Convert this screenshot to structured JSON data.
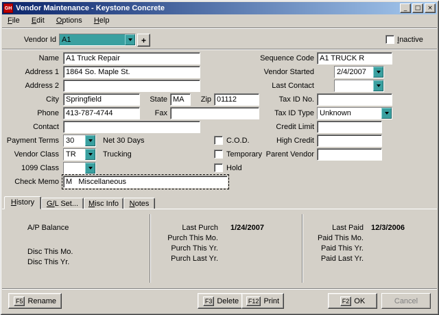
{
  "window": {
    "icon_label": "GH",
    "title": "Vendor Maintenance - Keystone Concrete",
    "minimize_glyph": "_",
    "maximize_glyph": "□",
    "close_glyph": "×"
  },
  "menu": {
    "file": "File",
    "edit": "Edit",
    "options": "Options",
    "help": "Help"
  },
  "topbar": {
    "vendor_id_label": "Vendor Id",
    "vendor_id_value": "A1",
    "add_button_label": "+",
    "inactive_label": "Inactive"
  },
  "fields": {
    "name_label": "Name",
    "name_value": "A1 Truck Repair",
    "address1_label": "Address 1",
    "address1_value": "1864 So. Maple St.",
    "address2_label": "Address 2",
    "address2_value": "",
    "city_label": "City",
    "city_value": "Springfield",
    "state_label": "State",
    "state_value": "MA",
    "zip_label": "Zip",
    "zip_value": "01112",
    "phone_label": "Phone",
    "phone_value": "413-787-4744",
    "fax_label": "Fax",
    "fax_value": "",
    "contact_label": "Contact",
    "contact_value": "",
    "payment_terms_label": "Payment Terms",
    "payment_terms_value": "30",
    "payment_terms_desc": "Net 30 Days",
    "vendor_class_label": "Vendor Class",
    "vendor_class_value": "TR",
    "vendor_class_desc": "Trucking",
    "class1099_label": "1099 Class",
    "class1099_value": "",
    "check_memo_label": "Check Memo",
    "check_memo_value": "M   Miscellaneous",
    "cod_label": "C.O.D.",
    "temporary_label": "Temporary",
    "hold_label": "Hold",
    "sequence_code_label": "Sequence Code",
    "sequence_code_value": "A1 TRUCK R",
    "vendor_started_label": "Vendor Started",
    "vendor_started_value": "2/4/2007",
    "last_contact_label": "Last Contact",
    "last_contact_value": "",
    "tax_id_no_label": "Tax ID No.",
    "tax_id_no_value": "",
    "tax_id_type_label": "Tax ID Type",
    "tax_id_type_value": "Unknown",
    "credit_limit_label": "Credit Limit",
    "credit_limit_value": "",
    "high_credit_label": "High Credit",
    "high_credit_value": "",
    "parent_vendor_label": "Parent Vendor",
    "parent_vendor_value": ""
  },
  "tabs": {
    "history": "History",
    "gl_set": "G/L Set...",
    "misc_info": "Misc Info",
    "notes": "Notes"
  },
  "history": {
    "ap_balance_label": "A/P Balance",
    "disc_this_mo_label": "Disc This Mo.",
    "disc_this_yr_label": "Disc This Yr.",
    "last_purch_label": "Last Purch",
    "last_purch_value": "1/24/2007",
    "purch_this_mo_label": "Purch This Mo.",
    "purch_this_yr_label": "Purch This Yr.",
    "purch_last_yr_label": "Purch Last Yr.",
    "last_paid_label": "Last Paid",
    "last_paid_value": "12/3/2006",
    "paid_this_mo_label": "Paid This Mo.",
    "paid_this_yr_label": "Paid This Yr.",
    "paid_last_yr_label": "Paid Last Yr."
  },
  "buttons": {
    "rename_key": "F5",
    "rename_label": "Rename",
    "delete_key": "F3",
    "delete_label": "Delete",
    "print_key": "F12",
    "print_label": "Print",
    "ok_key": "F2",
    "ok_label": "OK",
    "cancel_label": "Cancel"
  },
  "colors": {
    "titlebar_gradient_start": "#0a246a",
    "titlebar_gradient_end": "#a6caf0",
    "window_bg": "#d4d0c8",
    "combo_accent_teal": "#3aa0a0",
    "app_icon_red": "#c00000",
    "field_bg": "#ffffff"
  }
}
